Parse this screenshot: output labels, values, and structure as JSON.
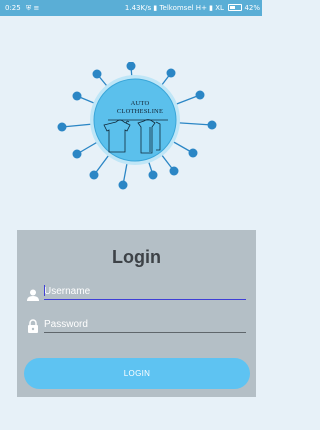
{
  "status_bar": {
    "time": "0:25",
    "notification_icons": "⛨ ≡",
    "network_speed": "1.43K/s",
    "carrier_1": "Telkomsel H+",
    "carrier_2": "XL",
    "battery": "42%"
  },
  "logo": {
    "line_1": "AUTO",
    "line_2": "CLOTHESLINE"
  },
  "login": {
    "title": "Login",
    "username_placeholder": "Username",
    "password_placeholder": "Password",
    "button_label": "LOGIN"
  },
  "colors": {
    "background": "#e7f1f8",
    "status_bar": "#5aaed6",
    "card": "#b4bfc6",
    "button": "#5ec3f2",
    "logo_circle": "#5bc0ec",
    "node": "#2b86c5",
    "active_underline": "#3f3fd6"
  },
  "icons": {
    "user": "user-icon",
    "lock": "lock-icon",
    "hanger": "hanger-icon",
    "shirt": "shirt-icon"
  }
}
